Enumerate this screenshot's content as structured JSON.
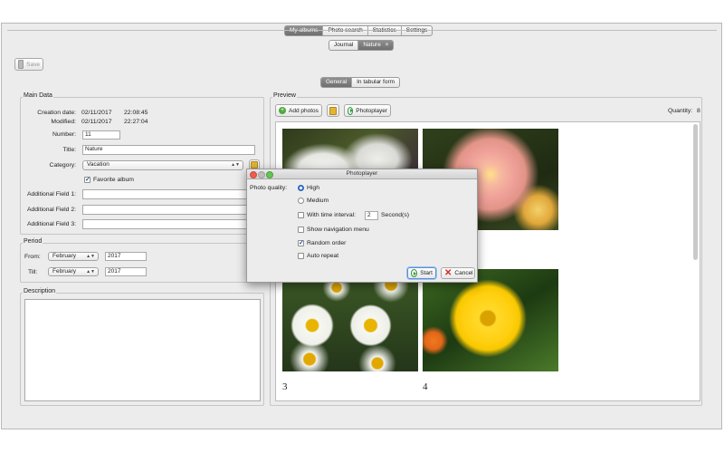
{
  "top_tabs": [
    "My albums",
    "Photo search",
    "Statistics",
    "Settings"
  ],
  "album_tabs": [
    {
      "label": "Journal"
    },
    {
      "label": "Nature",
      "close": "×"
    }
  ],
  "toolbar": {
    "save_label": "Save"
  },
  "view_tabs": [
    "General",
    "In tabular form"
  ],
  "main_data": {
    "title": "Main Data",
    "creation_label": "Creation date:",
    "creation_date": "02/11/2017",
    "creation_time": "22:08:45",
    "modified_label": "Modified:",
    "modified_date": "02/11/2017",
    "modified_time": "22:27:04",
    "number_label": "Number:",
    "number": "11",
    "title_label": "Title:",
    "title_value": "Nature",
    "category_label": "Category:",
    "category_value": "Vacation",
    "favorite_label": "Favorite album",
    "favorite_checked": true,
    "field1_label": "Additional Field 1:",
    "field2_label": "Additional Field 2:",
    "field3_label": "Additional Field 3:"
  },
  "period": {
    "title": "Period",
    "from_label": "From:",
    "from_month": "February",
    "from_year": "2017",
    "till_label": "Till:",
    "till_month": "February",
    "till_year": "2017"
  },
  "description": {
    "title": "Description"
  },
  "preview": {
    "title": "Preview",
    "add_photos": "Add photos",
    "photoplayer": "Photoplayer",
    "quantity_label": "Quantity:",
    "quantity": "8",
    "numbers": [
      "3",
      "4"
    ]
  },
  "dialog": {
    "title": "Photoplayer",
    "quality_label": "Photo quality:",
    "high": "High",
    "medium": "Medium",
    "interval_label": "With time interval:",
    "interval_value": "2",
    "seconds": "Second(s)",
    "nav_menu": "Show navigation menu",
    "random": "Random order",
    "auto_repeat": "Auto repeat",
    "start": "Start",
    "cancel": "Cancel"
  },
  "colors": {
    "accent": "#3a7be0",
    "tab_active": "#7d7d7d",
    "window_bg": "#ececec"
  }
}
